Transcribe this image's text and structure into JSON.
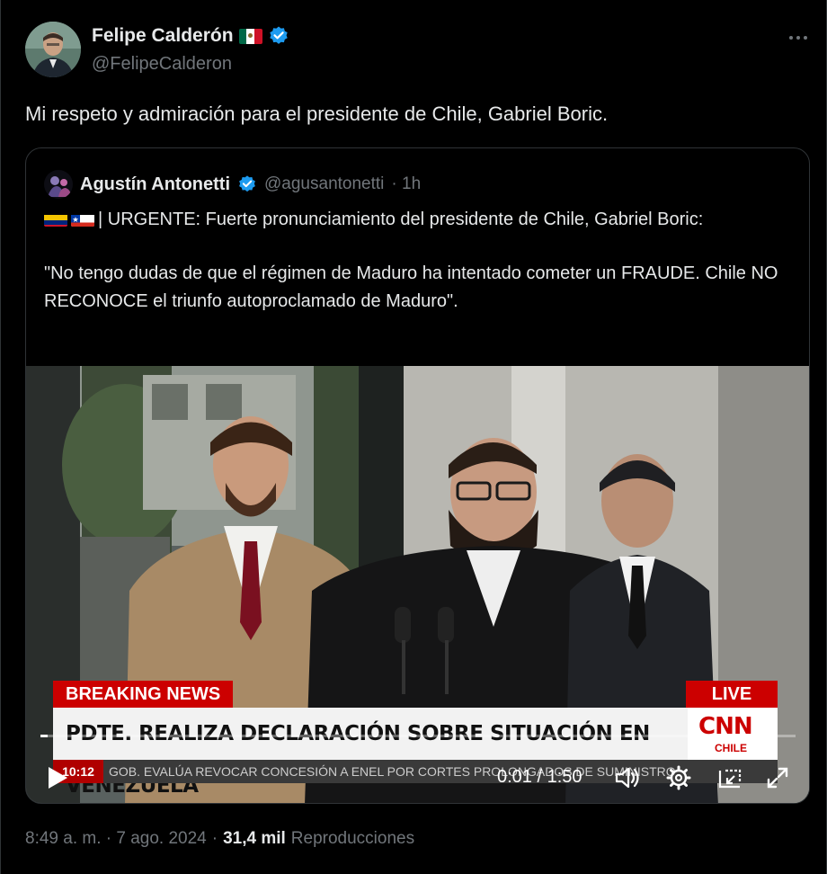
{
  "author": {
    "name": "Felipe Calderón",
    "handle": "@FelipeCalderon",
    "verified": true,
    "flag_icon": "mexico-flag-icon"
  },
  "tweet": {
    "text": "Mi respeto y admiración para el presidente de Chile, Gabriel Boric."
  },
  "quote": {
    "name": "Agustín Antonetti",
    "handle": "@agusantonetti",
    "time": "· 1h",
    "line1": "| URGENTE: Fuerte pronunciamiento del presidente de Chile, Gabriel Boric:",
    "line2": "\"No tengo dudas de que el régimen de Maduro ha intentado cometer un FRAUDE. Chile NO RECONOCE el triunfo autoproclamado de Maduro\".",
    "flag_icons": [
      "venezuela-flag-icon",
      "chile-flag-icon"
    ]
  },
  "video": {
    "breaking_label": "BREAKING NEWS",
    "live_label": "LIVE",
    "headline": "PDTE. REALIZA DECLARACIÓN SOBRE SITUACIÓN EN VENEZUELA",
    "network": "CNN",
    "network_sub": "CHILE",
    "clock": "10:12",
    "ticker": "GOB. EVALÚA REVOCAR CONCESIÓN A ENEL POR CORTES PROLONGADOS DE SUMINISTRO",
    "time_readout": "0:01 / 1:50",
    "progress": 0.009
  },
  "footer": {
    "timestamp": "8:49 a. m. · 7 ago. 2024",
    "separator": "·",
    "views": "31,4 mil",
    "views_label": "Reproducciones"
  },
  "colors": {
    "background": "#000000",
    "text": "#e7e9ea",
    "muted": "#71767b",
    "verified": "#1d9bf0",
    "border": "#2f3336",
    "cnn_red": "#cc0000"
  }
}
